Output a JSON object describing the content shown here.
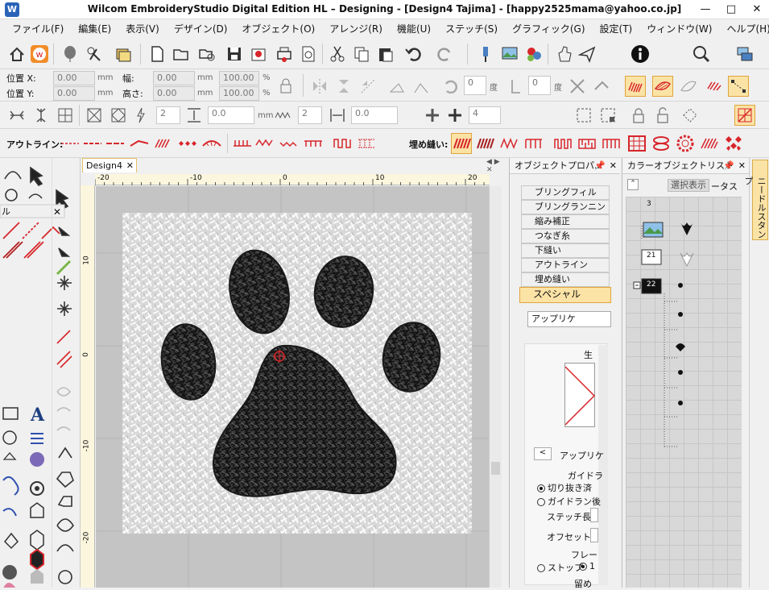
{
  "window": {
    "title": "Wilcom EmbroideryStudio Digital Edition HL – Designing - [Design4      Tajima] - [happy2525mama@yahoo.co.jp]",
    "minimize": "—",
    "maximize": "□",
    "close": "✕"
  },
  "menu": [
    "ファイル(F)",
    "編集(E)",
    "表示(V)",
    "デザイン(D)",
    "オブジェクト(O)",
    "アレンジ(R)",
    "機能(U)",
    "ステッチ(S)",
    "グラフィック(G)",
    "設定(T)",
    "ウィンドウ(W)",
    "ヘルプ(H)"
  ],
  "position": {
    "x_label": "位置 X:",
    "y_label": "位置 Y:",
    "x_value": "0.00",
    "y_value": "0.00",
    "unit": "mm",
    "width_label": "幅:",
    "height_label": "高さ:",
    "width_value": "0.00",
    "height_value": "0.00",
    "width_pct": "100.00",
    "height_pct": "100.00",
    "pct": "%"
  },
  "rotate": {
    "value1": "0",
    "unit1": "度",
    "value2": "0",
    "unit2": "度"
  },
  "toolbar3": {
    "value1": "2",
    "value2": "0.0",
    "unit": "mm",
    "value3": "2",
    "value4": "0.0",
    "value5": "4"
  },
  "outline_label": "アウトライン:",
  "fill_label": "埋め縫い:",
  "document_tab": "Design4",
  "ruler": {
    "top": [
      "-20",
      "-10",
      "0",
      "10",
      "20"
    ],
    "left": [
      "10",
      "0",
      "-10",
      "-20"
    ]
  },
  "object_panel": {
    "title": "オブジェクトプロパ...",
    "tabs": [
      "ブリングフィル",
      "ブリングランニング",
      "縮み補正",
      "つなぎ糸",
      "下縫い",
      "アウトライン",
      "埋め縫い",
      "スペシャル"
    ],
    "selected_type": "アップリケ",
    "preview_label": "生",
    "sub_label": "アップリケ",
    "guide_label": "ガイドラ",
    "radio1": "切り抜き済",
    "radio2": "ガイドラン後",
    "stitch_len": "ステッチ長:",
    "offset": "オフセット:",
    "frame": "フレー",
    "stop": "ストップ",
    "stop_value": "1",
    "stay": "留め"
  },
  "color_panel": {
    "title": "カラーオブジェクトリスト",
    "show_selected": "選択表示",
    "status": "ータス",
    "items": [
      {
        "label": "3"
      },
      {
        "label": "21"
      },
      {
        "label": "22"
      }
    ]
  },
  "right_tab": "ニードルスタンプ",
  "colors": {
    "accent": "#fbe3a6",
    "red": "#d7262b",
    "black": "#222222"
  }
}
